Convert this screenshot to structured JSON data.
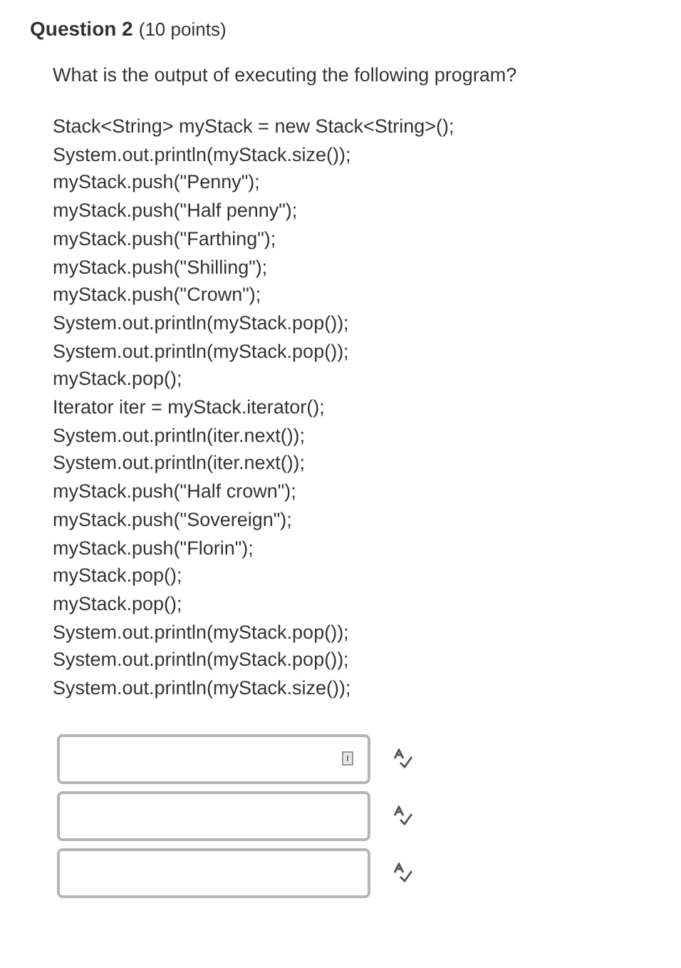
{
  "question": {
    "title": "Question 2",
    "points": "(10 points)",
    "prompt": "What is the output of executing the following program?",
    "code_lines": [
      "Stack<String> myStack = new Stack<String>();",
      "System.out.println(myStack.size());",
      "myStack.push(\"Penny\");",
      "myStack.push(\"Half penny\");",
      "myStack.push(\"Farthing\");",
      "myStack.push(\"Shilling\");",
      "myStack.push(\"Crown\");",
      "System.out.println(myStack.pop());",
      "System.out.println(myStack.pop());",
      "myStack.pop();",
      "Iterator iter = myStack.iterator();",
      "System.out.println(iter.next());",
      "System.out.println(iter.next());",
      "myStack.push(\"Half crown\");",
      "myStack.push(\"Sovereign\");",
      "myStack.push(\"Florin\");",
      "myStack.pop();",
      "myStack.pop();",
      "System.out.println(myStack.pop());",
      "System.out.println(myStack.pop());",
      "System.out.println(myStack.size());"
    ],
    "answers": [
      {
        "input_icon": true
      },
      {
        "input_icon": false
      },
      {
        "input_icon": false
      }
    ]
  }
}
